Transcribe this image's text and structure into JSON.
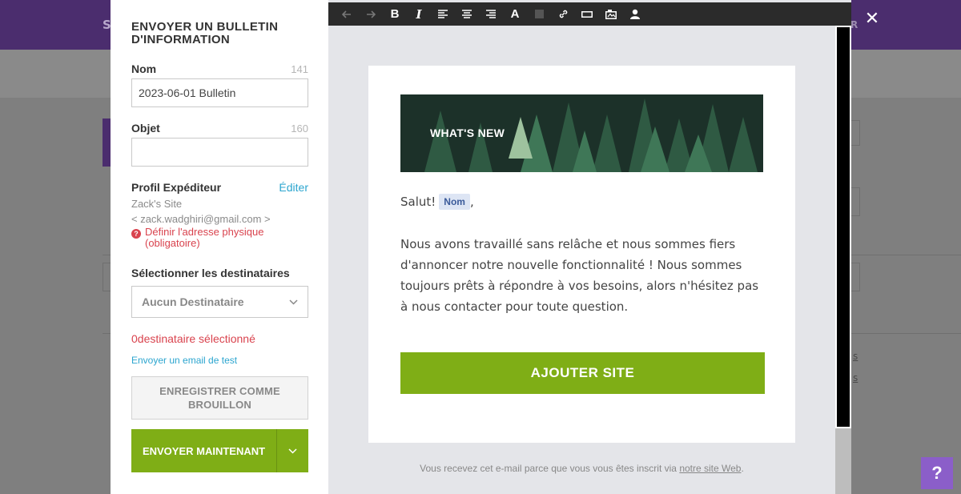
{
  "background": {
    "brand_letter": "S",
    "right_letter": "R",
    "links": [
      "s",
      "s"
    ]
  },
  "panel": {
    "title": "ENVOYER UN BULLETIN D'INFORMATION",
    "name_label": "Nom",
    "name_count": "141",
    "name_value": "2023-06-01 Bulletin",
    "subject_label": "Objet",
    "subject_count": "160",
    "subject_value": "",
    "sender_label": "Profil Expéditeur",
    "sender_edit": "Éditer",
    "sender_name": "Zack's Site",
    "sender_email": "< zack.wadghiri@gmail.com >",
    "address_warning": "Définir l'adresse physique (obligatoire)",
    "recipients_label": "Sélectionner les destinataires",
    "recipients_selected": "Aucun Destinataire",
    "recipients_status": "0destinataire sélectionné",
    "test_email_link": "Envoyer un email de test",
    "draft_button": "ENREGISTRER COMME BROUILLON",
    "send_button": "ENVOYER MAINTENANT"
  },
  "toolbar": {
    "bold": "B",
    "italic": "I",
    "font": "A"
  },
  "email": {
    "hero_text": "WHAT'S NEW",
    "greeting": "Salut!",
    "name_tag": "Nom",
    "greeting_suffix": ",",
    "body": "Nous avons travaillé sans relâche et nous sommes fiers d'annoncer notre nouvelle fonctionnalité ! Nous sommes toujours prêts à répondre à vos besoins, alors n'hésitez pas à nous contacter pour toute question.",
    "cta": "AJOUTER SITE",
    "footer_prefix": "Vous recevez cet e-mail parce que vous vous êtes inscrit via",
    "footer_link": "notre site Web",
    "footer_suffix": "."
  },
  "help_label": "?",
  "close_label": "✕",
  "colors": {
    "accent_green": "#7fae16",
    "link_blue": "#2ba5cf",
    "warning_red": "#d9434e",
    "help_purple": "#8b5ec9"
  }
}
